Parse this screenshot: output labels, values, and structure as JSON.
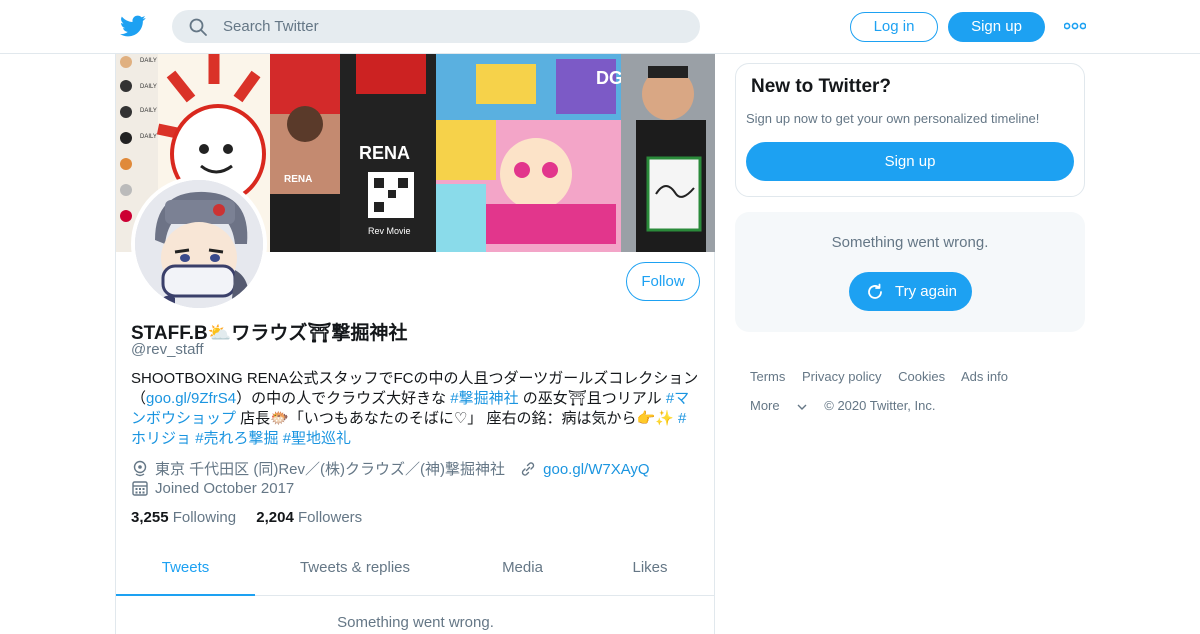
{
  "header": {
    "search_placeholder": "Search Twitter",
    "login_label": "Log in",
    "signup_label": "Sign up"
  },
  "profile": {
    "name": "STAFF.B⛅ワラウズ⛩撃掘神社",
    "handle": "@rev_staff",
    "follow_label": "Follow",
    "bio_parts": [
      {
        "t": "SHOOTBOXING RENA公式スタッフでFCの中の人且つダーツガールズコレクション（",
        "link": false
      },
      {
        "t": "goo.gl/9ZfrS4",
        "link": true
      },
      {
        "t": "）の中の人でクラウズ大好きな ",
        "link": false
      },
      {
        "t": "#撃掘神社",
        "link": true
      },
      {
        "t": " の巫女⛩且つリアル ",
        "link": false
      },
      {
        "t": "#マンボウショップ",
        "link": true
      },
      {
        "t": " 店長🐡「いつもあなたのそばに♡」 座右の銘：病は気から👉✨ ",
        "link": false
      },
      {
        "t": "#ホリジョ",
        "link": true
      },
      {
        "t": " ",
        "link": false
      },
      {
        "t": "#売れろ撃掘",
        "link": true
      },
      {
        "t": " ",
        "link": false
      },
      {
        "t": "#聖地巡礼",
        "link": true
      }
    ],
    "location": "東京 千代田区 (同)Rev／(株)クラウズ／(神)撃掘神社",
    "url": "goo.gl/W7XAyQ",
    "joined": "Joined October 2017",
    "following_count": "3,255",
    "following_label": "Following",
    "followers_count": "2,204",
    "followers_label": "Followers",
    "banner_texts": {
      "rena_small": "RENA",
      "rena_back": "RENA",
      "rev_movie": "Rev Movie",
      "dgc": "DGC",
      "daily": "DAILY"
    }
  },
  "tabs": [
    {
      "label": "Tweets",
      "active": true
    },
    {
      "label": "Tweets & replies",
      "active": false
    },
    {
      "label": "Media",
      "active": false
    },
    {
      "label": "Likes",
      "active": false
    }
  ],
  "timeline_error": "Something went wrong.",
  "sidebar": {
    "new_title": "New to Twitter?",
    "new_sub": "Sign up now to get your own personalized timeline!",
    "signup_label": "Sign up",
    "error_msg": "Something went wrong.",
    "retry_label": "Try again"
  },
  "footer": {
    "terms": "Terms",
    "privacy": "Privacy policy",
    "cookies": "Cookies",
    "ads": "Ads info",
    "more": "More",
    "copyright": "© 2020 Twitter, Inc."
  },
  "colors": {
    "accent": "#1da1f2",
    "link": "#1b95e0",
    "muted": "#657786",
    "border": "#e1e8ed"
  }
}
